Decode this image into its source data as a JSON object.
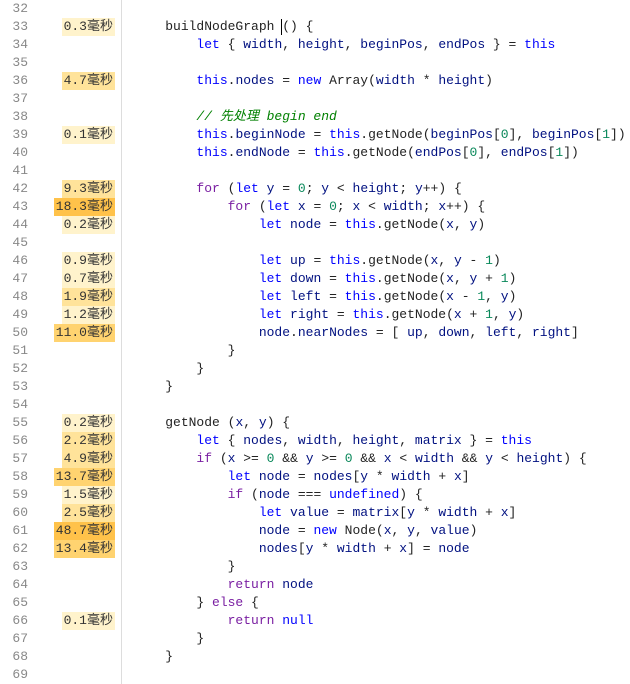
{
  "unit": "毫秒",
  "lines": [
    {
      "num": 32,
      "prof": null,
      "hl": "",
      "tokens": []
    },
    {
      "num": 33,
      "prof": "0.3",
      "hl": "hl1",
      "tokens": [
        {
          "c": "    "
        },
        {
          "c": "buildNodeGraph ",
          "cls": "tok-fn"
        },
        {
          "cursor": true
        },
        {
          "c": "() {",
          "cls": "tok-punc"
        }
      ]
    },
    {
      "num": 34,
      "prof": null,
      "hl": "",
      "tokens": [
        {
          "c": "        "
        },
        {
          "c": "let",
          "cls": "tok-kw2"
        },
        {
          "c": " { "
        },
        {
          "c": "width",
          "cls": "tok-id"
        },
        {
          "c": ", "
        },
        {
          "c": "height",
          "cls": "tok-id"
        },
        {
          "c": ", "
        },
        {
          "c": "beginPos",
          "cls": "tok-id"
        },
        {
          "c": ", "
        },
        {
          "c": "endPos",
          "cls": "tok-id"
        },
        {
          "c": " } = "
        },
        {
          "c": "this",
          "cls": "tok-this"
        }
      ]
    },
    {
      "num": 35,
      "prof": null,
      "hl": "",
      "tokens": []
    },
    {
      "num": 36,
      "prof": "4.7",
      "hl": "hl2",
      "tokens": [
        {
          "c": "        "
        },
        {
          "c": "this",
          "cls": "tok-this"
        },
        {
          "c": "."
        },
        {
          "c": "nodes",
          "cls": "tok-prop"
        },
        {
          "c": " = "
        },
        {
          "c": "new",
          "cls": "tok-kw2"
        },
        {
          "c": " "
        },
        {
          "c": "Array",
          "cls": "tok-fn"
        },
        {
          "c": "("
        },
        {
          "c": "width",
          "cls": "tok-id"
        },
        {
          "c": " * "
        },
        {
          "c": "height",
          "cls": "tok-id"
        },
        {
          "c": ")"
        }
      ]
    },
    {
      "num": 37,
      "prof": null,
      "hl": "",
      "tokens": []
    },
    {
      "num": 38,
      "prof": null,
      "hl": "",
      "tokens": [
        {
          "c": "        "
        },
        {
          "c": "// 先处理 begin end",
          "cls": "tok-com"
        }
      ]
    },
    {
      "num": 39,
      "prof": "0.1",
      "hl": "hl1",
      "tokens": [
        {
          "c": "        "
        },
        {
          "c": "this",
          "cls": "tok-this"
        },
        {
          "c": "."
        },
        {
          "c": "beginNode",
          "cls": "tok-prop"
        },
        {
          "c": " = "
        },
        {
          "c": "this",
          "cls": "tok-this"
        },
        {
          "c": "."
        },
        {
          "c": "getNode",
          "cls": "tok-fn"
        },
        {
          "c": "("
        },
        {
          "c": "beginPos",
          "cls": "tok-id"
        },
        {
          "c": "["
        },
        {
          "c": "0",
          "cls": "tok-num"
        },
        {
          "c": "], "
        },
        {
          "c": "beginPos",
          "cls": "tok-id"
        },
        {
          "c": "["
        },
        {
          "c": "1",
          "cls": "tok-num"
        },
        {
          "c": "])"
        }
      ]
    },
    {
      "num": 40,
      "prof": null,
      "hl": "",
      "tokens": [
        {
          "c": "        "
        },
        {
          "c": "this",
          "cls": "tok-this"
        },
        {
          "c": "."
        },
        {
          "c": "endNode",
          "cls": "tok-prop"
        },
        {
          "c": " = "
        },
        {
          "c": "this",
          "cls": "tok-this"
        },
        {
          "c": "."
        },
        {
          "c": "getNode",
          "cls": "tok-fn"
        },
        {
          "c": "("
        },
        {
          "c": "endPos",
          "cls": "tok-id"
        },
        {
          "c": "["
        },
        {
          "c": "0",
          "cls": "tok-num"
        },
        {
          "c": "], "
        },
        {
          "c": "endPos",
          "cls": "tok-id"
        },
        {
          "c": "["
        },
        {
          "c": "1",
          "cls": "tok-num"
        },
        {
          "c": "])"
        }
      ]
    },
    {
      "num": 41,
      "prof": null,
      "hl": "",
      "tokens": []
    },
    {
      "num": 42,
      "prof": "9.3",
      "hl": "hl2",
      "tokens": [
        {
          "c": "        "
        },
        {
          "c": "for",
          "cls": "tok-kw"
        },
        {
          "c": " ("
        },
        {
          "c": "let",
          "cls": "tok-kw2"
        },
        {
          "c": " "
        },
        {
          "c": "y",
          "cls": "tok-id"
        },
        {
          "c": " = "
        },
        {
          "c": "0",
          "cls": "tok-num"
        },
        {
          "c": "; "
        },
        {
          "c": "y",
          "cls": "tok-id"
        },
        {
          "c": " < "
        },
        {
          "c": "height",
          "cls": "tok-id"
        },
        {
          "c": "; "
        },
        {
          "c": "y",
          "cls": "tok-id"
        },
        {
          "c": "++) {"
        }
      ]
    },
    {
      "num": 43,
      "prof": "18.3",
      "hl": "hl4",
      "tokens": [
        {
          "c": "            "
        },
        {
          "c": "for",
          "cls": "tok-kw"
        },
        {
          "c": " ("
        },
        {
          "c": "let",
          "cls": "tok-kw2"
        },
        {
          "c": " "
        },
        {
          "c": "x",
          "cls": "tok-id"
        },
        {
          "c": " = "
        },
        {
          "c": "0",
          "cls": "tok-num"
        },
        {
          "c": "; "
        },
        {
          "c": "x",
          "cls": "tok-id"
        },
        {
          "c": " < "
        },
        {
          "c": "width",
          "cls": "tok-id"
        },
        {
          "c": "; "
        },
        {
          "c": "x",
          "cls": "tok-id"
        },
        {
          "c": "++) {"
        }
      ]
    },
    {
      "num": 44,
      "prof": "0.2",
      "hl": "hl1",
      "tokens": [
        {
          "c": "                "
        },
        {
          "c": "let",
          "cls": "tok-kw2"
        },
        {
          "c": " "
        },
        {
          "c": "node",
          "cls": "tok-id"
        },
        {
          "c": " = "
        },
        {
          "c": "this",
          "cls": "tok-this"
        },
        {
          "c": "."
        },
        {
          "c": "getNode",
          "cls": "tok-fn"
        },
        {
          "c": "("
        },
        {
          "c": "x",
          "cls": "tok-id"
        },
        {
          "c": ", "
        },
        {
          "c": "y",
          "cls": "tok-id"
        },
        {
          "c": ")"
        }
      ]
    },
    {
      "num": 45,
      "prof": null,
      "hl": "",
      "tokens": []
    },
    {
      "num": 46,
      "prof": "0.9",
      "hl": "hl1",
      "tokens": [
        {
          "c": "                "
        },
        {
          "c": "let",
          "cls": "tok-kw2"
        },
        {
          "c": " "
        },
        {
          "c": "up",
          "cls": "tok-id"
        },
        {
          "c": " = "
        },
        {
          "c": "this",
          "cls": "tok-this"
        },
        {
          "c": "."
        },
        {
          "c": "getNode",
          "cls": "tok-fn"
        },
        {
          "c": "("
        },
        {
          "c": "x",
          "cls": "tok-id"
        },
        {
          "c": ", "
        },
        {
          "c": "y",
          "cls": "tok-id"
        },
        {
          "c": " - "
        },
        {
          "c": "1",
          "cls": "tok-num"
        },
        {
          "c": ")"
        }
      ]
    },
    {
      "num": 47,
      "prof": "0.7",
      "hl": "hl1",
      "tokens": [
        {
          "c": "                "
        },
        {
          "c": "let",
          "cls": "tok-kw2"
        },
        {
          "c": " "
        },
        {
          "c": "down",
          "cls": "tok-id"
        },
        {
          "c": " = "
        },
        {
          "c": "this",
          "cls": "tok-this"
        },
        {
          "c": "."
        },
        {
          "c": "getNode",
          "cls": "tok-fn"
        },
        {
          "c": "("
        },
        {
          "c": "x",
          "cls": "tok-id"
        },
        {
          "c": ", "
        },
        {
          "c": "y",
          "cls": "tok-id"
        },
        {
          "c": " + "
        },
        {
          "c": "1",
          "cls": "tok-num"
        },
        {
          "c": ")"
        }
      ]
    },
    {
      "num": 48,
      "prof": "1.9",
      "hl": "hl2",
      "tokens": [
        {
          "c": "                "
        },
        {
          "c": "let",
          "cls": "tok-kw2"
        },
        {
          "c": " "
        },
        {
          "c": "left",
          "cls": "tok-id"
        },
        {
          "c": " = "
        },
        {
          "c": "this",
          "cls": "tok-this"
        },
        {
          "c": "."
        },
        {
          "c": "getNode",
          "cls": "tok-fn"
        },
        {
          "c": "("
        },
        {
          "c": "x",
          "cls": "tok-id"
        },
        {
          "c": " - "
        },
        {
          "c": "1",
          "cls": "tok-num"
        },
        {
          "c": ", "
        },
        {
          "c": "y",
          "cls": "tok-id"
        },
        {
          "c": ")"
        }
      ]
    },
    {
      "num": 49,
      "prof": "1.2",
      "hl": "hl1",
      "tokens": [
        {
          "c": "                "
        },
        {
          "c": "let",
          "cls": "tok-kw2"
        },
        {
          "c": " "
        },
        {
          "c": "right",
          "cls": "tok-id"
        },
        {
          "c": " = "
        },
        {
          "c": "this",
          "cls": "tok-this"
        },
        {
          "c": "."
        },
        {
          "c": "getNode",
          "cls": "tok-fn"
        },
        {
          "c": "("
        },
        {
          "c": "x",
          "cls": "tok-id"
        },
        {
          "c": " + "
        },
        {
          "c": "1",
          "cls": "tok-num"
        },
        {
          "c": ", "
        },
        {
          "c": "y",
          "cls": "tok-id"
        },
        {
          "c": ")"
        }
      ]
    },
    {
      "num": 50,
      "prof": "11.0",
      "hl": "hl3",
      "tokens": [
        {
          "c": "                "
        },
        {
          "c": "node",
          "cls": "tok-id"
        },
        {
          "c": "."
        },
        {
          "c": "nearNodes",
          "cls": "tok-prop"
        },
        {
          "c": " = [ "
        },
        {
          "c": "up",
          "cls": "tok-id"
        },
        {
          "c": ", "
        },
        {
          "c": "down",
          "cls": "tok-id"
        },
        {
          "c": ", "
        },
        {
          "c": "left",
          "cls": "tok-id"
        },
        {
          "c": ", "
        },
        {
          "c": "right",
          "cls": "tok-id"
        },
        {
          "c": "]"
        }
      ]
    },
    {
      "num": 51,
      "prof": null,
      "hl": "",
      "tokens": [
        {
          "c": "            }"
        }
      ]
    },
    {
      "num": 52,
      "prof": null,
      "hl": "",
      "tokens": [
        {
          "c": "        }"
        }
      ]
    },
    {
      "num": 53,
      "prof": null,
      "hl": "",
      "tokens": [
        {
          "c": "    }"
        }
      ]
    },
    {
      "num": 54,
      "prof": null,
      "hl": "",
      "tokens": []
    },
    {
      "num": 55,
      "prof": "0.2",
      "hl": "hl1",
      "tokens": [
        {
          "c": "    "
        },
        {
          "c": "getNode ",
          "cls": "tok-fn"
        },
        {
          "c": "("
        },
        {
          "c": "x",
          "cls": "tok-id"
        },
        {
          "c": ", "
        },
        {
          "c": "y",
          "cls": "tok-id"
        },
        {
          "c": ") {"
        }
      ]
    },
    {
      "num": 56,
      "prof": "2.2",
      "hl": "hl2",
      "tokens": [
        {
          "c": "        "
        },
        {
          "c": "let",
          "cls": "tok-kw2"
        },
        {
          "c": " { "
        },
        {
          "c": "nodes",
          "cls": "tok-id"
        },
        {
          "c": ", "
        },
        {
          "c": "width",
          "cls": "tok-id"
        },
        {
          "c": ", "
        },
        {
          "c": "height",
          "cls": "tok-id"
        },
        {
          "c": ", "
        },
        {
          "c": "matrix",
          "cls": "tok-id"
        },
        {
          "c": " } = "
        },
        {
          "c": "this",
          "cls": "tok-this"
        }
      ]
    },
    {
      "num": 57,
      "prof": "4.9",
      "hl": "hl2",
      "tokens": [
        {
          "c": "        "
        },
        {
          "c": "if",
          "cls": "tok-kw"
        },
        {
          "c": " ("
        },
        {
          "c": "x",
          "cls": "tok-id"
        },
        {
          "c": " >= "
        },
        {
          "c": "0",
          "cls": "tok-num"
        },
        {
          "c": " && "
        },
        {
          "c": "y",
          "cls": "tok-id"
        },
        {
          "c": " >= "
        },
        {
          "c": "0",
          "cls": "tok-num"
        },
        {
          "c": " && "
        },
        {
          "c": "x",
          "cls": "tok-id"
        },
        {
          "c": " < "
        },
        {
          "c": "width",
          "cls": "tok-id"
        },
        {
          "c": " && "
        },
        {
          "c": "y",
          "cls": "tok-id"
        },
        {
          "c": " < "
        },
        {
          "c": "height",
          "cls": "tok-id"
        },
        {
          "c": ") {"
        }
      ]
    },
    {
      "num": 58,
      "prof": "13.7",
      "hl": "hl3",
      "tokens": [
        {
          "c": "            "
        },
        {
          "c": "let",
          "cls": "tok-kw2"
        },
        {
          "c": " "
        },
        {
          "c": "node",
          "cls": "tok-id"
        },
        {
          "c": " = "
        },
        {
          "c": "nodes",
          "cls": "tok-id"
        },
        {
          "c": "["
        },
        {
          "c": "y",
          "cls": "tok-id"
        },
        {
          "c": " * "
        },
        {
          "c": "width",
          "cls": "tok-id"
        },
        {
          "c": " + "
        },
        {
          "c": "x",
          "cls": "tok-id"
        },
        {
          "c": "]"
        }
      ]
    },
    {
      "num": 59,
      "prof": "1.5",
      "hl": "hl1",
      "tokens": [
        {
          "c": "            "
        },
        {
          "c": "if",
          "cls": "tok-kw"
        },
        {
          "c": " ("
        },
        {
          "c": "node",
          "cls": "tok-id"
        },
        {
          "c": " === "
        },
        {
          "c": "undefined",
          "cls": "tok-const"
        },
        {
          "c": ") {"
        }
      ]
    },
    {
      "num": 60,
      "prof": "2.5",
      "hl": "hl2",
      "tokens": [
        {
          "c": "                "
        },
        {
          "c": "let",
          "cls": "tok-kw2"
        },
        {
          "c": " "
        },
        {
          "c": "value",
          "cls": "tok-id"
        },
        {
          "c": " = "
        },
        {
          "c": "matrix",
          "cls": "tok-id"
        },
        {
          "c": "["
        },
        {
          "c": "y",
          "cls": "tok-id"
        },
        {
          "c": " * "
        },
        {
          "c": "width",
          "cls": "tok-id"
        },
        {
          "c": " + "
        },
        {
          "c": "x",
          "cls": "tok-id"
        },
        {
          "c": "]"
        }
      ]
    },
    {
      "num": 61,
      "prof": "48.7",
      "hl": "hl4",
      "tokens": [
        {
          "c": "                "
        },
        {
          "c": "node",
          "cls": "tok-id"
        },
        {
          "c": " = "
        },
        {
          "c": "new",
          "cls": "tok-kw2"
        },
        {
          "c": " "
        },
        {
          "c": "Node",
          "cls": "tok-fn"
        },
        {
          "c": "("
        },
        {
          "c": "x",
          "cls": "tok-id"
        },
        {
          "c": ", "
        },
        {
          "c": "y",
          "cls": "tok-id"
        },
        {
          "c": ", "
        },
        {
          "c": "value",
          "cls": "tok-id"
        },
        {
          "c": ")"
        }
      ]
    },
    {
      "num": 62,
      "prof": "13.4",
      "hl": "hl3",
      "tokens": [
        {
          "c": "                "
        },
        {
          "c": "nodes",
          "cls": "tok-id"
        },
        {
          "c": "["
        },
        {
          "c": "y",
          "cls": "tok-id"
        },
        {
          "c": " * "
        },
        {
          "c": "width",
          "cls": "tok-id"
        },
        {
          "c": " + "
        },
        {
          "c": "x",
          "cls": "tok-id"
        },
        {
          "c": "] = "
        },
        {
          "c": "node",
          "cls": "tok-id"
        }
      ]
    },
    {
      "num": 63,
      "prof": null,
      "hl": "",
      "tokens": [
        {
          "c": "            }"
        }
      ]
    },
    {
      "num": 64,
      "prof": null,
      "hl": "",
      "tokens": [
        {
          "c": "            "
        },
        {
          "c": "return",
          "cls": "tok-kw"
        },
        {
          "c": " "
        },
        {
          "c": "node",
          "cls": "tok-id"
        }
      ]
    },
    {
      "num": 65,
      "prof": null,
      "hl": "",
      "tokens": [
        {
          "c": "        } "
        },
        {
          "c": "else",
          "cls": "tok-kw"
        },
        {
          "c": " {"
        }
      ]
    },
    {
      "num": 66,
      "prof": "0.1",
      "hl": "hl1",
      "tokens": [
        {
          "c": "            "
        },
        {
          "c": "return",
          "cls": "tok-kw"
        },
        {
          "c": " "
        },
        {
          "c": "null",
          "cls": "tok-const"
        }
      ]
    },
    {
      "num": 67,
      "prof": null,
      "hl": "",
      "tokens": [
        {
          "c": "        }"
        }
      ]
    },
    {
      "num": 68,
      "prof": null,
      "hl": "",
      "tokens": [
        {
          "c": "    }"
        }
      ]
    },
    {
      "num": 69,
      "prof": null,
      "hl": "",
      "tokens": []
    }
  ]
}
